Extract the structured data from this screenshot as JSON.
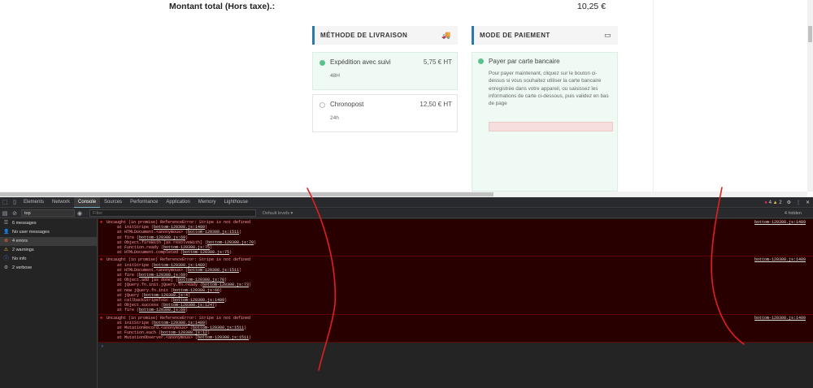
{
  "site": {
    "total_label": "Montant total (Hors taxe).:",
    "total_value": "10,25 €",
    "shipping_header": "MÉTHODE DE LIVRAISON",
    "payment_header": "MODE DE PAIEMENT",
    "shipping_options": [
      {
        "name": "Expédition avec suivi",
        "price": "5,75 € HT",
        "sub": "48H",
        "selected": true
      },
      {
        "name": "Chronopost",
        "price": "12,50 € HT",
        "sub": "24h",
        "selected": false
      }
    ],
    "payment": {
      "name": "Payer par carte bancaire",
      "description": "Pour payer maintenant, cliquez sur le bouton ci-dessus si vous souhaitez utiliser la carte bancaire enregistrée dans votre appareil, ou saisissez les informations de carte ci-dessous, puis validez en bas de page"
    }
  },
  "devtools": {
    "tabs": [
      "Elements",
      "Network",
      "Console",
      "Sources",
      "Performance",
      "Application",
      "Memory",
      "Lighthouse"
    ],
    "active_tab": "Console",
    "error_count": "4",
    "warning_count": "2",
    "context": "top",
    "filter_placeholder": "Filter",
    "levels": "Default levels ▾",
    "hidden": "4 hidden",
    "sidebar": [
      {
        "label": "6 messages",
        "icon": "list-icon"
      },
      {
        "label": "No user messages",
        "icon": "user-icon"
      },
      {
        "label": "4 errors",
        "icon": "error-icon"
      },
      {
        "label": "2 warnings",
        "icon": "warning-icon"
      },
      {
        "label": "No info",
        "icon": "info-icon"
      },
      {
        "label": "2 verbose",
        "icon": "verbose-icon"
      }
    ],
    "messages": [
      {
        "text": "Uncaught (in promise) ReferenceError: Stripe is not defined",
        "source": "bottom-120308.js:1489",
        "frames": [
          [
            "at initStripe (",
            "bottom-120308.js:1489",
            ")"
          ],
          [
            "at HTMLDocument.<anonymous> (",
            "bottom-120308.js:1511",
            ")"
          ],
          [
            "at fire (",
            "bottom-120308.js:69",
            ")"
          ],
          [
            "at Object.fireWith [as resolveWith] (",
            "bottom-120308.js:70",
            ")"
          ],
          [
            "at Function.ready (",
            "bottom-120308.js:75",
            ")"
          ],
          [
            "at HTMLDocument.completed (",
            "bottom-120308.js:75",
            ")"
          ]
        ]
      },
      {
        "text": "Uncaught (in promise) ReferenceError: Stripe is not defined",
        "source": "bottom-120308.js:1489",
        "frames": [
          [
            "at initStripe (",
            "bottom-120308.js:1489",
            ")"
          ],
          [
            "at HTMLDocument.<anonymous> (",
            "bottom-120308.js:1511",
            ")"
          ],
          [
            "at fire (",
            "bottom-120308.js:69",
            ")"
          ],
          [
            "at Object.add [as done] (",
            "bottom-120308.js:70",
            ")"
          ],
          [
            "at jQuery.fn.init.jQuery.fn.ready (",
            "bottom-120308.js:73",
            ")"
          ],
          [
            "at new jQuery.fn.init (",
            "bottom-120308.js:66",
            ")"
          ],
          [
            "at jQuery (",
            "bottom-120308.js:4",
            ")"
          ],
          [
            "at callbackStripeToSc (",
            "bottom-120308.js:1489",
            ")"
          ],
          [
            "at Object.success (",
            "bottom-120308.js:1247",
            ")"
          ],
          [
            "at fire (",
            "bottom-120308.js:69",
            ")"
          ]
        ]
      },
      {
        "text": "Uncaught (in promise) ReferenceError: Stripe is not defined",
        "source": "bottom-120308.js:1489",
        "frames": [
          [
            "at initStripe (",
            "bottom-120308.js:1489",
            ")"
          ],
          [
            "at MutationRecord.<anonymous> (",
            "bottom-120308.js:1511",
            ")"
          ],
          [
            "at Function.each (",
            "bottom-120308.js:12",
            ")"
          ],
          [
            "at MutationObserver.<anonymous> (",
            "bottom-120308.js:1511",
            ")"
          ]
        ]
      }
    ]
  },
  "colors": {
    "accent": "#2a7aa8",
    "selected_bg": "#eefaf3",
    "error_bg": "#290000",
    "error_text": "#f59aa0",
    "annotation": "#e02020"
  }
}
